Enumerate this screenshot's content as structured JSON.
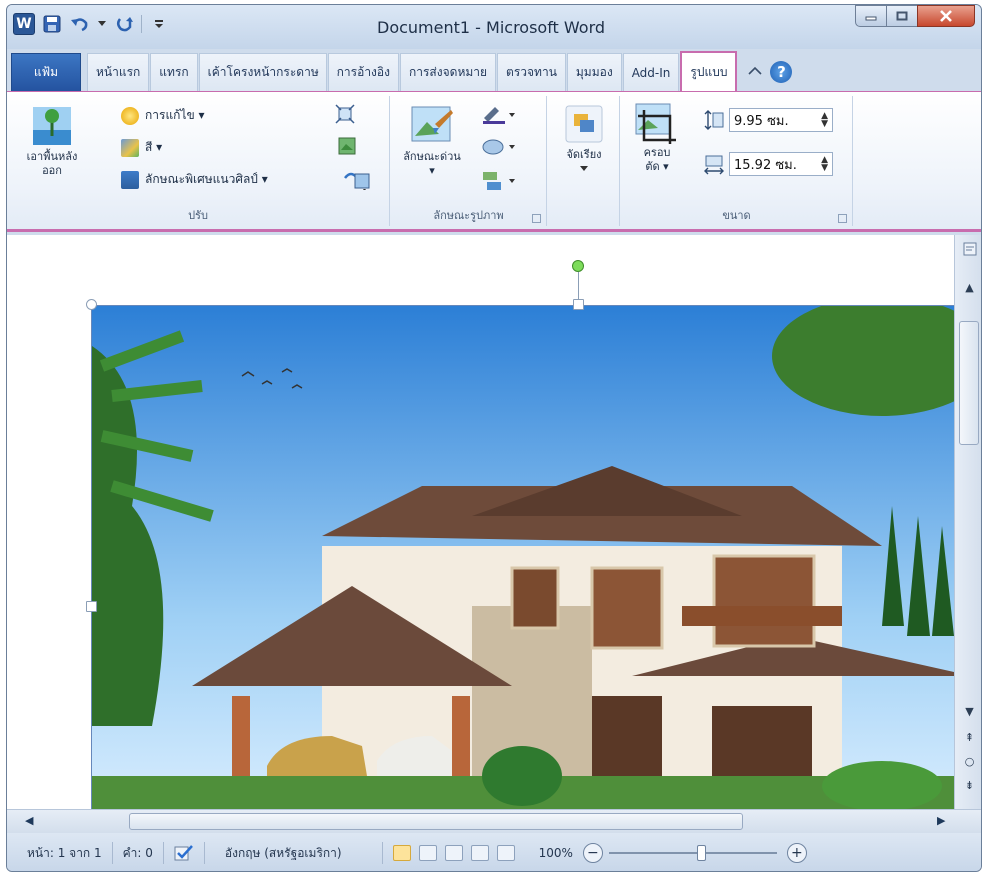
{
  "window": {
    "title": "Document1  -  Microsoft Word",
    "word_logo": "W"
  },
  "tabs": [
    {
      "label": "แฟ้ม",
      "active": false
    },
    {
      "label": "หน้าแรก",
      "active": false
    },
    {
      "label": "แทรก",
      "active": false
    },
    {
      "label": "เค้าโครงหน้ากระดาษ",
      "active": false
    },
    {
      "label": "การอ้างอิง",
      "active": false
    },
    {
      "label": "การส่งจดหมาย",
      "active": false
    },
    {
      "label": "ตรวจทาน",
      "active": false
    },
    {
      "label": "มุมมอง",
      "active": false
    },
    {
      "label": "Add-In",
      "active": false
    },
    {
      "label": "รูปแบบ",
      "active": true
    }
  ],
  "ribbon": {
    "adjust": {
      "label": "ปรับ",
      "remove_bg": "เอาพื้นหลังออก",
      "corrections": "การแก้ไข ▾",
      "color": "สี ▾",
      "artistic": "ลักษณะพิเศษแนวศิลป์ ▾"
    },
    "styles": {
      "label": "ลักษณะรูปภาพ",
      "quick_styles": "ลักษณะด่วน ▾"
    },
    "arrange": {
      "label": "จัดเรียง"
    },
    "size": {
      "label": "ขนาด",
      "crop": "ครอบตัด ▾",
      "height": "9.95 ซม.",
      "width": "15.92 ซม."
    }
  },
  "status": {
    "page": "หน้า: 1 จาก 1",
    "words": "คำ: 0",
    "language": "อังกฤษ (สหรัฐอเมริกา)",
    "zoom": "100%",
    "zoom_minus": "−",
    "zoom_plus": "+"
  },
  "colors": {
    "accent": "#c86cae",
    "file_tab": "#2b5797"
  }
}
